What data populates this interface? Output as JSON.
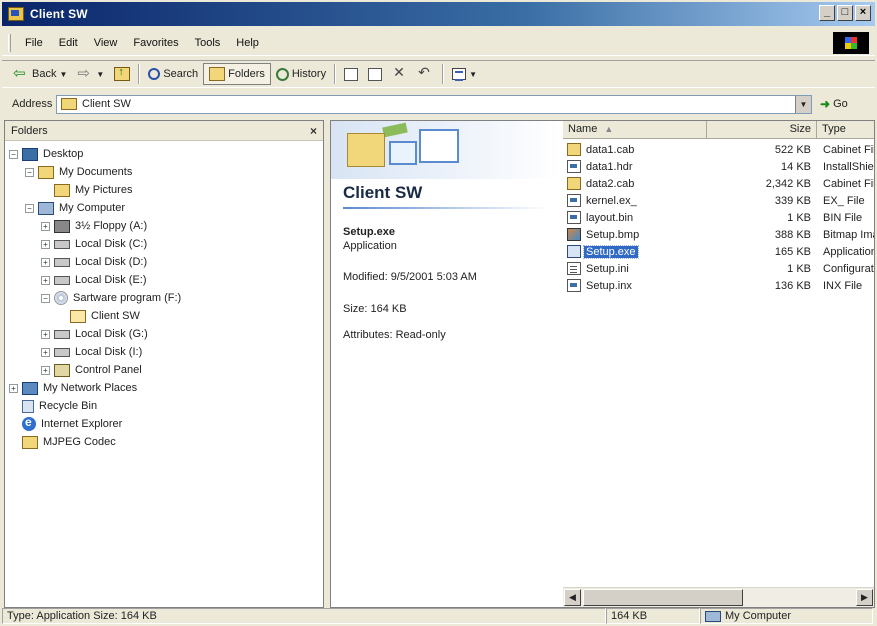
{
  "window": {
    "title": "Client SW",
    "controls": {
      "minimize": "_",
      "maximize": "□",
      "close": "×"
    }
  },
  "menu": [
    "File",
    "Edit",
    "View",
    "Favorites",
    "Tools",
    "Help"
  ],
  "toolbar": {
    "back": "Back",
    "search": "Search",
    "folders": "Folders",
    "history": "History"
  },
  "address": {
    "label": "Address",
    "value": "Client SW",
    "go": "Go"
  },
  "folders_pane": {
    "title": "Folders",
    "close": "×",
    "tree": [
      {
        "label": "Desktop",
        "icon": "desktop-icon",
        "expander": "minus",
        "indent": 0
      },
      {
        "label": "My Documents",
        "icon": "folder-icon",
        "expander": "minus",
        "indent": 1
      },
      {
        "label": "My Pictures",
        "icon": "folder-icon",
        "expander": "none",
        "indent": 2
      },
      {
        "label": "My Computer",
        "icon": "computer-icon",
        "expander": "minus",
        "indent": 1
      },
      {
        "label": "3½ Floppy (A:)",
        "icon": "floppy-icon",
        "expander": "plus",
        "indent": 2
      },
      {
        "label": "Local Disk (C:)",
        "icon": "disk-icon",
        "expander": "plus",
        "indent": 2
      },
      {
        "label": "Local Disk (D:)",
        "icon": "disk-icon",
        "expander": "plus",
        "indent": 2
      },
      {
        "label": "Local Disk (E:)",
        "icon": "disk-icon",
        "expander": "plus",
        "indent": 2
      },
      {
        "label": "Sartware program (F:)",
        "icon": "cd-icon",
        "expander": "minus",
        "indent": 2
      },
      {
        "label": "Client SW",
        "icon": "folder-open-icon",
        "expander": "none",
        "indent": 3
      },
      {
        "label": "Local Disk (G:)",
        "icon": "disk-icon",
        "expander": "plus",
        "indent": 2
      },
      {
        "label": "Local Disk (I:)",
        "icon": "disk-icon",
        "expander": "plus",
        "indent": 2
      },
      {
        "label": "Control Panel",
        "icon": "control-panel-icon",
        "expander": "plus",
        "indent": 2
      },
      {
        "label": "My Network Places",
        "icon": "network-icon",
        "expander": "plus",
        "indent": 0
      },
      {
        "label": "Recycle Bin",
        "icon": "recycle-bin-icon",
        "expander": "none",
        "indent": 0
      },
      {
        "label": "Internet Explorer",
        "icon": "ie-icon",
        "expander": "none",
        "indent": 0
      },
      {
        "label": "MJPEG Codec",
        "icon": "folder-icon",
        "expander": "none",
        "indent": 0
      }
    ]
  },
  "webview": {
    "folder_title": "Client SW",
    "selected_name": "Setup.exe",
    "selected_type": "Application",
    "modified": "Modified: 9/5/2001 5:03 AM",
    "size": "Size: 164 KB",
    "attributes": "Attributes: Read-only"
  },
  "filelist": {
    "columns": {
      "name": "Name",
      "size": "Size",
      "type": "Type"
    },
    "rows": [
      {
        "name": "data1.cab",
        "size": "522 KB",
        "type": "Cabinet File",
        "icon": "cabinet-icon",
        "selected": false
      },
      {
        "name": "data1.hdr",
        "size": "14 KB",
        "type": "InstallShield",
        "icon": "file-icon",
        "selected": false
      },
      {
        "name": "data2.cab",
        "size": "2,342 KB",
        "type": "Cabinet File",
        "icon": "cabinet-icon",
        "selected": false
      },
      {
        "name": "kernel.ex_",
        "size": "339 KB",
        "type": "EX_ File",
        "icon": "file-icon",
        "selected": false
      },
      {
        "name": "layout.bin",
        "size": "1 KB",
        "type": "BIN File",
        "icon": "file-icon",
        "selected": false
      },
      {
        "name": "Setup.bmp",
        "size": "388 KB",
        "type": "Bitmap Image",
        "icon": "bitmap-icon",
        "selected": false
      },
      {
        "name": "Setup.exe",
        "size": "165 KB",
        "type": "Application",
        "icon": "exe-icon",
        "selected": true
      },
      {
        "name": "Setup.ini",
        "size": "1 KB",
        "type": "Configuration",
        "icon": "ini-icon",
        "selected": false
      },
      {
        "name": "Setup.inx",
        "size": "136 KB",
        "type": "INX File",
        "icon": "file-icon",
        "selected": false
      }
    ]
  },
  "statusbar": {
    "main": "Type: Application Size: 164 KB",
    "size": "164 KB",
    "zone": "My Computer"
  }
}
